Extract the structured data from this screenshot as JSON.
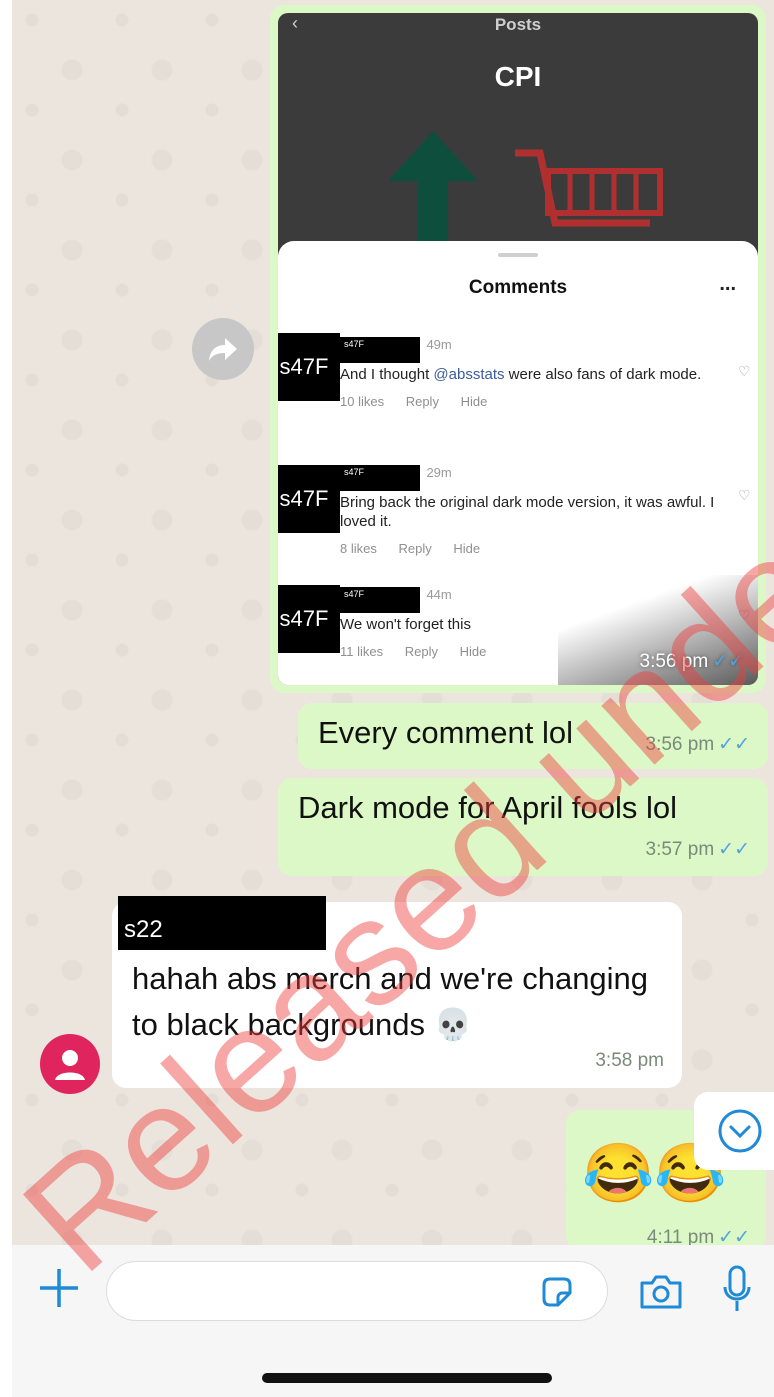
{
  "screenshot": {
    "header": "Posts",
    "post_title": "CPI",
    "comments_title": "Comments",
    "more": "...",
    "comments": [
      {
        "avatar_label": "s47F",
        "name_label": "s47F",
        "time": "49m",
        "text_before": "And I thought ",
        "mention": "@absstats",
        "text_after": " were also fans of dark mode.",
        "likes": "10 likes",
        "reply": "Reply",
        "hide": "Hide"
      },
      {
        "avatar_label": "s47F",
        "name_label": "s47F",
        "time": "29m",
        "text": "Bring back the original dark mode version, it was awful. I loved it.",
        "likes": "8 likes",
        "reply": "Reply",
        "hide": "Hide"
      },
      {
        "avatar_label": "s47F",
        "name_label": "s47F",
        "time": "44m",
        "text": "We won't forget this",
        "likes": "11 likes",
        "reply": "Reply",
        "hide": "Hide"
      }
    ],
    "time": "3:56 pm",
    "ticks": "✓✓"
  },
  "messages": {
    "m1": {
      "text": "Every comment lol",
      "time": "3:56 pm",
      "ticks": "✓✓"
    },
    "m2": {
      "text": "Dark mode for April fools lol",
      "time": "3:57 pm",
      "ticks": "✓✓"
    },
    "m3": {
      "sender": "s22",
      "text": "hahah abs merch and we're changing to black backgrounds 💀",
      "time": "3:58 pm"
    },
    "m4": {
      "emoji": "😂😂",
      "time": "4:11 pm",
      "ticks": "✓✓"
    }
  },
  "input": {
    "placeholder": ""
  },
  "watermark": "Released under FOI",
  "colors": {
    "outgoing": "#dcf8c6",
    "incoming": "#ffffff",
    "tick": "#4fa3e0",
    "watermark": "#f03c3c"
  }
}
